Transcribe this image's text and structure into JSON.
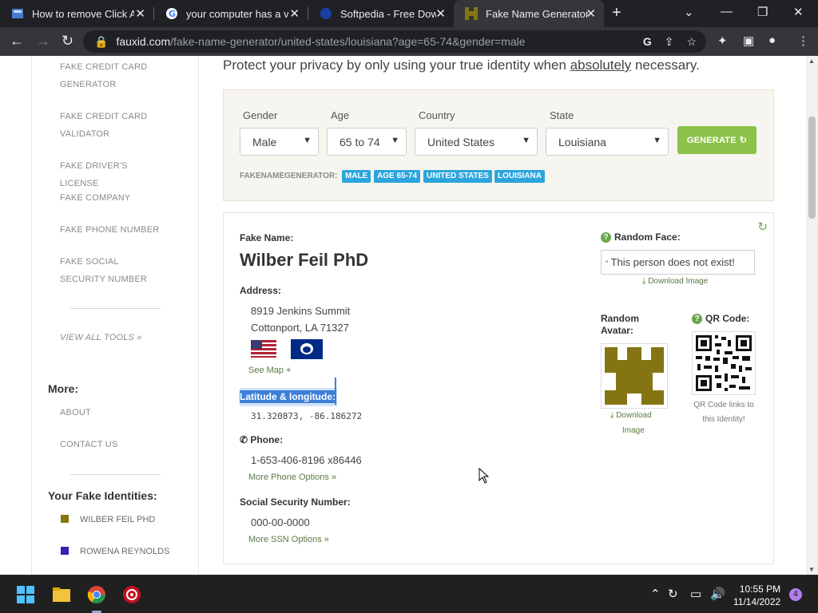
{
  "browser": {
    "tabs": [
      {
        "title": "How to remove Click A"
      },
      {
        "title": "your computer has a vi"
      },
      {
        "title": "Softpedia - Free Downl"
      },
      {
        "title": "Fake Name Generator |"
      }
    ],
    "url_host": "fauxid.com",
    "url_path": "/fake-name-generator/united-states/louisiana?age=65-74&gender=male"
  },
  "sidebar": {
    "tools": [
      {
        "label": "Fake Credit Card Generator"
      },
      {
        "label": "Fake Credit Card Validator"
      },
      {
        "label": "Fake Driver's License"
      },
      {
        "label": "Fake Company"
      },
      {
        "label": "Fake Phone Number"
      },
      {
        "label": "Fake Social Security Number"
      }
    ],
    "view_all": "VIEW ALL TOOLS »",
    "more_heading": "More:",
    "more_links": [
      {
        "label": "About"
      },
      {
        "label": "Contact Us"
      }
    ],
    "identities_heading": "Your Fake Identities:",
    "identities": [
      {
        "label": "Wilber Feil PhD",
        "color": "#857512"
      },
      {
        "label": "Rowena Reynolds",
        "color": "#3323b5"
      }
    ]
  },
  "main": {
    "privacy_prefix": "Protect your privacy by only using your true identity when ",
    "privacy_emph": "absolutely",
    "privacy_suffix": " necessary.",
    "form": {
      "gender_label": "Gender",
      "gender_value": "Male",
      "age_label": "Age",
      "age_value": "65 to 74",
      "country_label": "Country",
      "country_value": "United States",
      "state_label": "State",
      "state_value": "Louisiana",
      "generate_label": "GENERATE",
      "crumb_label": "FAKENAMEGENERATOR:",
      "tags": [
        "MALE",
        "AGE 65-74",
        "UNITED STATES",
        "LOUISIANA"
      ]
    },
    "card": {
      "name_label": "Fake Name:",
      "name": "Wilber Feil PhD",
      "address_label": "Address:",
      "address_line1": "8919 Jenkins Summit",
      "address_line2": "Cottonport, LA 71327",
      "see_map": "See Map",
      "latlng_label": "Latitude & longitude:",
      "latlng_value": "31.320873, -86.186272",
      "phone_label": "Phone:",
      "phone_value": "1-653-406-8196 x86446",
      "more_phone": "More Phone Options »",
      "ssn_label": "Social Security Number:",
      "ssn_value": "000-00-0000",
      "more_ssn": "More SSN Options »",
      "random_face_label": "Random Face:",
      "face_alt": "This person does not exist!",
      "download_image": "Download Image",
      "avatar_label_1": "Random",
      "avatar_label_2": "Avatar:",
      "avatar_download_1": "Download",
      "avatar_download_2": "Image",
      "avatar_color": "#857512",
      "qr_label": "QR Code:",
      "qr_note": "QR Code links to this Identity!"
    }
  },
  "taskbar": {
    "time": "10:55 PM",
    "date": "11/14/2022",
    "notifications": "4"
  }
}
